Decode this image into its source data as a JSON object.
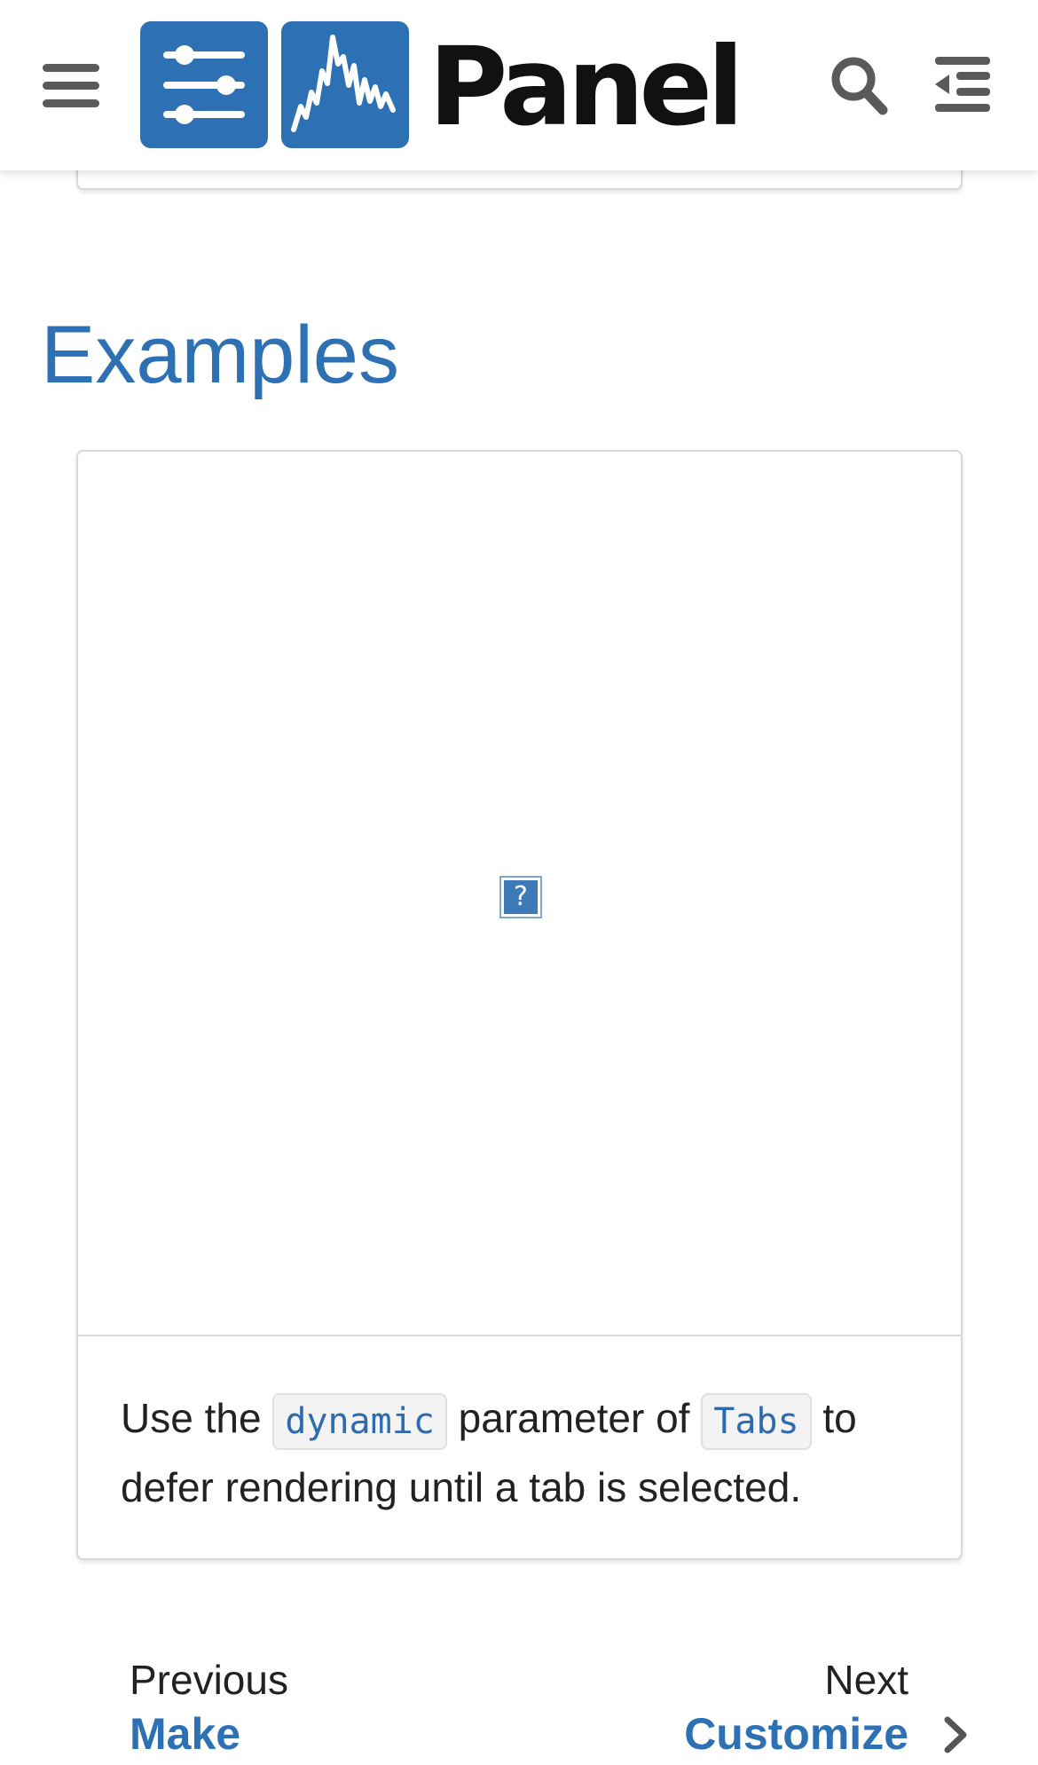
{
  "header": {
    "menu_icon": "hamburger-menu-icon",
    "logo_icons": [
      "sliders-logo-icon",
      "chart-line-logo-icon"
    ],
    "logo_text": "Panel",
    "search_icon": "search-icon",
    "toc_icon": "toc-collapse-icon"
  },
  "colors": {
    "accent": "#2d70b3",
    "text": "#222222",
    "border": "#d8d8d8",
    "code_bg": "#f3f3f3"
  },
  "main": {
    "heading": "Examples",
    "example_card": {
      "image_placeholder_icon": "broken-image-icon",
      "image_placeholder_text": "?",
      "caption_part1": "Use the ",
      "caption_code1": "dynamic",
      "caption_part2": " parameter of ",
      "caption_code2": "Tabs",
      "caption_part3": " to defer rendering until a tab is selected."
    }
  },
  "footer_nav": {
    "previous_label": "Previous",
    "previous_title": "Make",
    "next_label": "Next",
    "next_title": "Customize",
    "next_icon": "chevron-right-icon"
  }
}
